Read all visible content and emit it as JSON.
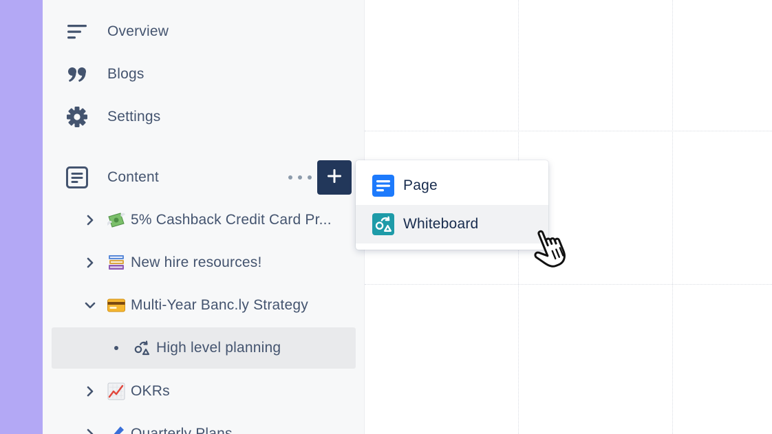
{
  "colors": {
    "accent_strip": "#b3a8f5",
    "sidebar_bg": "#f7f8f9",
    "add_button_bg": "#22375a",
    "page_icon": "#1d7afc",
    "whiteboard_icon": "#1e9ba8",
    "text": "#44546f"
  },
  "sidebar": {
    "nav": [
      {
        "label": "Overview",
        "icon": "overview-lines-icon"
      },
      {
        "label": "Blogs",
        "icon": "quote-icon"
      },
      {
        "label": "Settings",
        "icon": "gear-icon"
      }
    ],
    "content": {
      "label": "Content",
      "icon": "document-icon",
      "more_icon": "more-dots-icon",
      "add_icon": "plus-icon"
    },
    "tree": [
      {
        "label": "5% Cashback Credit Card Pr...",
        "emoji": "money-with-wings-icon",
        "expanded": false
      },
      {
        "label": "New hire resources!",
        "emoji": "books-icon",
        "expanded": false
      },
      {
        "label": "Multi-Year Banc.ly Strategy",
        "emoji": "credit-card-icon",
        "expanded": true
      },
      {
        "label": "High level planning",
        "emoji": "whiteboard-shapes-icon",
        "child": true,
        "selected": true
      },
      {
        "label": "OKRs",
        "emoji": "chart-increasing-icon",
        "expanded": false
      },
      {
        "label": "Quarterly Plans",
        "emoji": "writing-hand-icon",
        "expanded": false
      }
    ]
  },
  "create_menu": {
    "items": [
      {
        "label": "Page",
        "icon": "page-icon"
      },
      {
        "label": "Whiteboard",
        "icon": "whiteboard-icon",
        "hovered": true
      }
    ]
  }
}
